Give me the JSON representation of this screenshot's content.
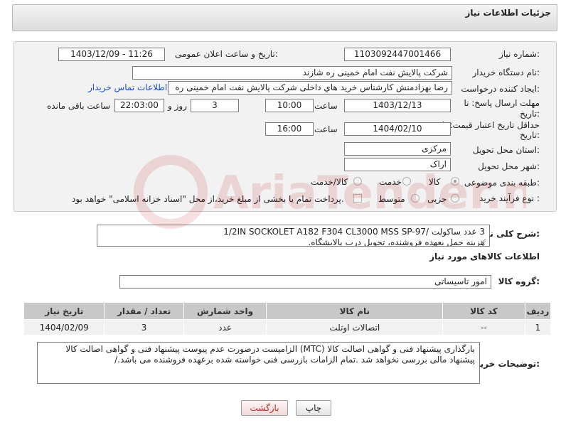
{
  "header": {
    "title": "جزئیات اطلاعات نیاز"
  },
  "form": {
    "need_number": {
      "label": "شماره نیاز:",
      "value": "1103092447001466"
    },
    "announce_datetime": {
      "label": "تاریخ و ساعت اعلان عمومی:",
      "value": "1403/12/09 - 11:26"
    },
    "buyer_org": {
      "label": "نام دستگاه خریدار:",
      "value": "شرکت پالایش نفت امام خمینی  ره  شازند"
    },
    "requester": {
      "label": "ایجاد کننده درخواست:",
      "value": "رضا بهزادمنش کارشناس خرید هاي داخلی  شرکت پالایش نفت امام خمینی  ره",
      "contact_link": "اطلاعات تماس خریدار"
    },
    "reply_deadline": {
      "label_line1": "مهلت ارسال پاسخ: تا",
      "label_line2": "تاریخ:",
      "date": "1403/12/13",
      "time_label": "ساعت",
      "time": "10:00",
      "days": "3",
      "days_label": "روز و",
      "remaining": "22:03:00",
      "remaining_label": "ساعت باقی مانده"
    },
    "price_validity": {
      "label_line1": "حداقل تاریخ اعتبار قیمت: تا",
      "label_line2": "تاریخ:",
      "date": "1404/02/10",
      "time_label": "ساعت",
      "time": "16:00"
    },
    "province": {
      "label": "استان محل تحویل:",
      "value": "مرکزی"
    },
    "city": {
      "label": "شهر محل تحویل:",
      "value": "اراک"
    },
    "category": {
      "label": "طبقه بندی موضوعی:",
      "options": [
        "کالا",
        "خدمت",
        "کالا/خدمت"
      ],
      "selected": "کالا"
    },
    "purchase_type": {
      "label": "نوع فرآیند خرید :",
      "options": [
        "جزیی",
        "متوسط"
      ],
      "payment_note": "پرداخت تمام یا بخشی از مبلغ خرید،از محل \"اسناد خزانه اسلامی\" خواهد بود."
    }
  },
  "description": {
    "label": "شرح کلی نیاز:",
    "line1": "3  عدد ساکولت /1/2IN SOCKOLET A182 F304 CL3000 MSS SP-97",
    "line2": "هزینه حمل بعهده فروشنده، تحویل درب پالایشگاه."
  },
  "goods_info": {
    "section_title": "اطلاعات کالاهای مورد نیاز",
    "group_label": "گروه کالا:",
    "group_value": "امور تاسیساتی"
  },
  "goods_table": {
    "columns": [
      "ردیف",
      "کد کالا",
      "نام کالا",
      "واحد شمارش",
      "تعداد / مقدار",
      "تاریخ نیاز"
    ],
    "rows": [
      [
        "1",
        "--",
        "اتصالات اوتلت",
        "عدد",
        "3",
        "1404/02/09"
      ]
    ]
  },
  "buyer_notes": {
    "label": "توضیحات خریدار:",
    "line1": "بارگذاری پیشنهاد فنی و گواهی اصالت کالا (MTC)  الزامیست درصورت عدم پیوست پیشنهاد فنی و گواهی اصالت کالا",
    "line2": "پیشنهاد مالی بررسی نخواهد شد .تمام الزامات بازرسی فنی خواسته شده برعهده فروشنده می باشد./"
  },
  "buttons": {
    "print": "چاپ",
    "back": "بازگشت"
  },
  "watermark": {
    "text": "AriaTender.net"
  },
  "colors": {
    "link": "#1a4fc9",
    "table_header": "#c8c8c8",
    "back_button_text": "#b03030"
  }
}
